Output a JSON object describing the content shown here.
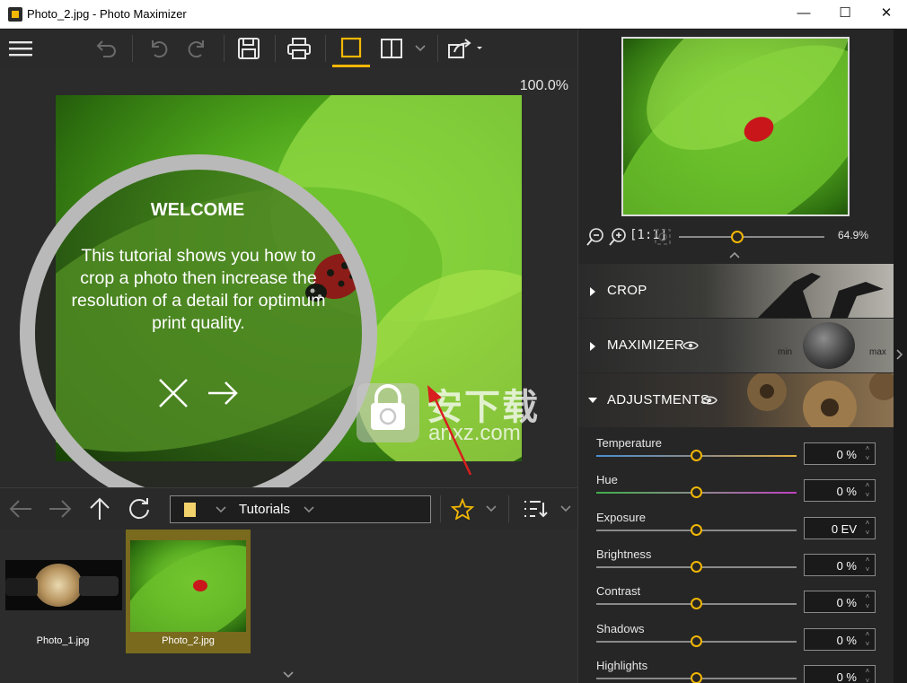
{
  "window": {
    "title": "Photo_2.jpg - Photo Maximizer",
    "minimize": "—",
    "maximize": "☐",
    "close": "✕"
  },
  "toolbar": {
    "icons": [
      "menu-icon",
      "undo-all-icon",
      "undo-icon",
      "redo-icon",
      "save-icon",
      "print-icon",
      "single-view-icon",
      "split-view-icon",
      "share-icon"
    ]
  },
  "canvas": {
    "zoom": "100.0%",
    "tutorial": {
      "title": "WELCOME",
      "body": "This tutorial shows you how to crop a photo then increase the resolution of a detail for optimum print quality."
    },
    "watermark_text": "安下载",
    "watermark_sub": "anxz.com"
  },
  "navigation": {
    "folder": "Tutorials"
  },
  "filmstrip": {
    "items": [
      {
        "label": "Photo_1.jpg",
        "selected": false
      },
      {
        "label": "Photo_2.jpg",
        "selected": true
      }
    ]
  },
  "preview": {
    "zoom": "64.9%",
    "slider_fraction": 0.4
  },
  "sections": [
    {
      "label": "CROP",
      "expanded": false
    },
    {
      "label": "MAXIMIZER",
      "expanded": false,
      "min_label": "min",
      "max_label": "max"
    },
    {
      "label": "ADJUSTMENTS",
      "expanded": true
    }
  ],
  "adjustments": [
    {
      "label": "Temperature",
      "value": "0 %",
      "fraction": 0.5,
      "track": "temperature"
    },
    {
      "label": "Hue",
      "value": "0 %",
      "fraction": 0.5,
      "track": "hue"
    },
    {
      "label": "Exposure",
      "value": "0 EV",
      "fraction": 0.5,
      "track": "plain"
    },
    {
      "label": "Brightness",
      "value": "0 %",
      "fraction": 0.5,
      "track": "plain"
    },
    {
      "label": "Contrast",
      "value": "0 %",
      "fraction": 0.5,
      "track": "plain"
    },
    {
      "label": "Shadows",
      "value": "0 %",
      "fraction": 0.5,
      "track": "plain"
    },
    {
      "label": "Highlights",
      "value": "0 %",
      "fraction": 0.5,
      "track": "plain"
    }
  ],
  "colors": {
    "accent": "#f2b705",
    "selected_thumb": "#7a6a1e"
  }
}
